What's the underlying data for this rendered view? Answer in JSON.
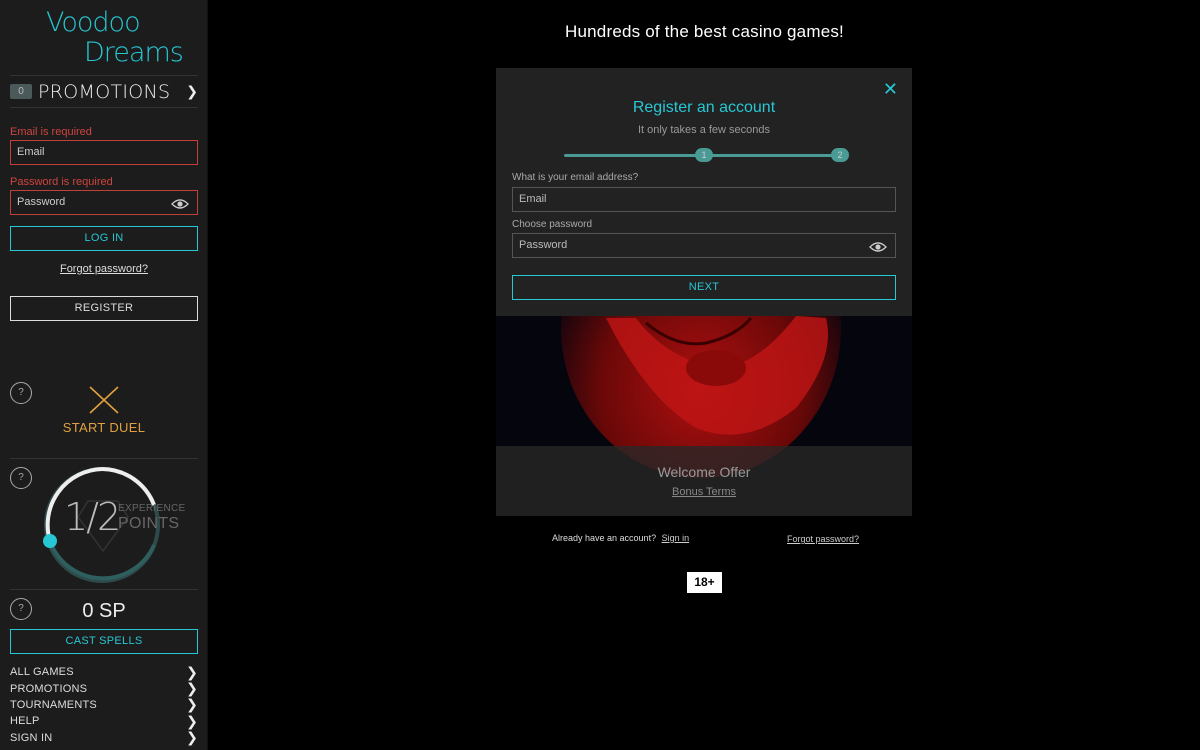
{
  "brand": {
    "line1": "Voodoo",
    "line2": "Dreams",
    "accent": "#27c7d3"
  },
  "sidebar": {
    "promotions": {
      "count": "0",
      "label": "PROMOTIONS"
    },
    "login": {
      "email_error": "Email is required",
      "email_placeholder": "Email",
      "password_error": "Password is required",
      "password_placeholder": "Password",
      "login_label": "LOG IN",
      "forgot_label": "Forgot password?",
      "register_label": "REGISTER"
    },
    "help_mark": "?",
    "duel_label": "START DUEL",
    "experience": {
      "value": "1/2",
      "label_small": "EXPERIENCE",
      "label_big": "POINTS"
    },
    "spells": {
      "value": "0 SP",
      "cast_label": "CAST SPELLS"
    },
    "nav": [
      {
        "label": "ALL GAMES"
      },
      {
        "label": "PROMOTIONS"
      },
      {
        "label": "TOURNAMENTS"
      },
      {
        "label": "HELP"
      },
      {
        "label": "SIGN IN"
      }
    ],
    "chevron": "❯"
  },
  "main": {
    "headline": "Hundreds of the best casino games!",
    "modal": {
      "close": "✕",
      "title": "Register an account",
      "subtitle": "It only takes a few seconds",
      "steps": [
        "1",
        "2"
      ],
      "email_label": "What is your email address?",
      "email_placeholder": "Email",
      "password_label": "Choose password",
      "password_placeholder": "Password",
      "next_label": "NEXT"
    },
    "welcome": {
      "title": "Welcome Offer",
      "terms": "Bonus Terms"
    },
    "already_text": "Already have an account?",
    "sign_in_link": "Sign in",
    "forgot_link": "Forgot password?",
    "age_badge": "18+"
  }
}
